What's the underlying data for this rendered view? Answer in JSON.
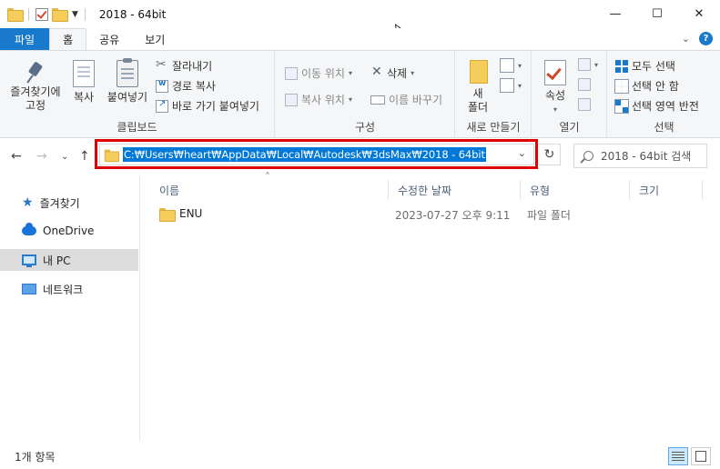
{
  "window": {
    "title": "2018 - 64bit",
    "minimize": "—",
    "maximize": "☐",
    "close": "✕"
  },
  "ribbon_tabs": [
    {
      "label": "파일"
    },
    {
      "label": "홈"
    },
    {
      "label": "공유"
    },
    {
      "label": "보기"
    }
  ],
  "clipboard": {
    "pin_label_line1": "즐겨찾기에",
    "pin_label_line2": "고정",
    "copy": "복사",
    "paste": "붙여넣기",
    "cut": "잘라내기",
    "copy_path": "경로 복사",
    "paste_shortcut": "바로 가기 붙여넣기",
    "group": "클립보드"
  },
  "organize": {
    "move_to": "이동 위치",
    "copy_to": "복사 위치",
    "delete": "삭제",
    "rename": "이름 바꾸기",
    "group": "구성"
  },
  "new": {
    "new_folder_line1": "새",
    "new_folder_line2": "폴더",
    "group": "새로 만들기"
  },
  "open": {
    "properties": "속성",
    "group": "열기"
  },
  "select": {
    "select_all": "모두 선택",
    "select_none": "선택 안 함",
    "invert": "선택 영역 반전",
    "group": "선택"
  },
  "address": {
    "path": "C:₩Users₩heart₩AppData₩Local₩Autodesk₩3dsMax₩2018 - 64bit",
    "search_placeholder": "2018 - 64bit 검색"
  },
  "nav_pane": [
    {
      "label": "즐겨찾기"
    },
    {
      "label": "OneDrive"
    },
    {
      "label": "내 PC"
    },
    {
      "label": "네트워크"
    }
  ],
  "columns": {
    "name": "이름",
    "modified": "수정한 날짜",
    "type": "유형",
    "size": "크기"
  },
  "files": [
    {
      "name": "ENU",
      "modified": "2023-07-27 오후 9:11",
      "type": "파일 폴더",
      "size": ""
    }
  ],
  "status": {
    "count": "1개 항목"
  },
  "colors": {
    "file_tab": "#1979ca",
    "selection": "#0078d7",
    "highlight_box": "#e00000"
  }
}
